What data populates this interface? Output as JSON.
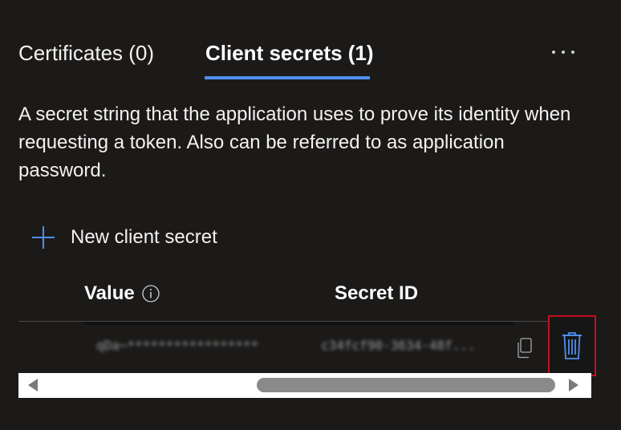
{
  "tabs": [
    {
      "label": "Certificates (0)",
      "selected": false
    },
    {
      "label": "Client secrets (1)",
      "selected": true
    }
  ],
  "more_icon": "more-horizontal-icon",
  "description": "A secret string that the application uses to prove its identity when requesting a token. Also can be referred to as application password.",
  "toolbar": {
    "new_secret_label": "New client secret",
    "new_secret_icon": "plus-icon"
  },
  "table": {
    "columns": [
      {
        "label": "Value",
        "icon": "info-icon"
      },
      {
        "label": "Secret ID"
      }
    ],
    "rows": [
      {
        "value": "qDa~*****************",
        "secret_id": "c34fcf90-3634-48f...",
        "copy_icon": "copy-icon",
        "delete_icon": "delete-icon"
      }
    ]
  },
  "colors": {
    "background": "#1b1a19",
    "accent": "#4f8ff0",
    "delete_highlight": "#c50f1f"
  }
}
